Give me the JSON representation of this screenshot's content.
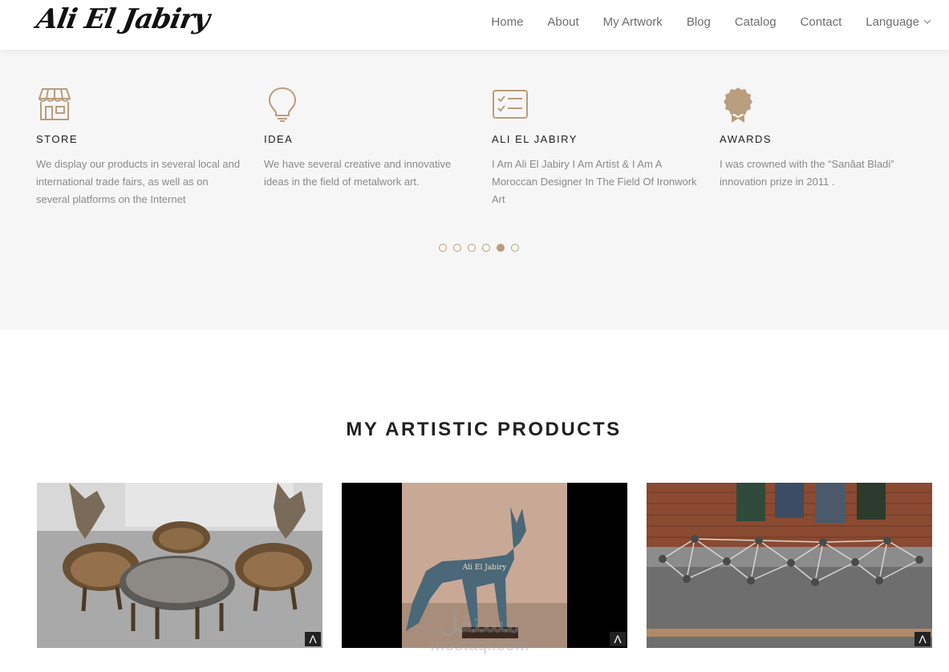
{
  "header": {
    "logo_text": "Ali El Jabiry",
    "nav": [
      {
        "label": "Home"
      },
      {
        "label": "About"
      },
      {
        "label": "My Artwork"
      },
      {
        "label": "Blog"
      },
      {
        "label": "Catalog"
      },
      {
        "label": "Contact"
      },
      {
        "label": "Language"
      }
    ]
  },
  "features": [
    {
      "icon": "store-icon",
      "title": "STORE",
      "desc": "We display our products in several local and international trade fairs, as well as on several platforms on the Internet"
    },
    {
      "icon": "lightbulb-icon",
      "title": "IDEA",
      "desc": "We have several creative and innovative ideas in the field of metalwork art."
    },
    {
      "icon": "checklist-icon",
      "title": "ALI EL JABIRY",
      "desc": "I Am Ali El Jabiry I Am Artist & I Am A Moroccan Designer In The Field Of Ironwork Art"
    },
    {
      "icon": "award-icon",
      "title": "AWARDS",
      "desc": "I was crowned with the “Sanâat Bladi” innovation prize in 2011 ."
    }
  ],
  "carousel": {
    "count": 6,
    "active_index": 4
  },
  "products_section": {
    "title": "MY ARTISTIC PRODUCTS"
  },
  "products": [
    {
      "name": "metal-chairs-and-table",
      "badge": "Λ"
    },
    {
      "name": "metal-fox-sculpture",
      "badge": "Λ",
      "caption": "Ali El Jabiry"
    },
    {
      "name": "metal-spheres-structure",
      "badge": "Λ"
    }
  ],
  "watermark": {
    "arabic": "مستقل",
    "latin": "mostaql.com"
  },
  "colors": {
    "accent": "#b99d7e",
    "band_bg": "#f6f6f6"
  }
}
